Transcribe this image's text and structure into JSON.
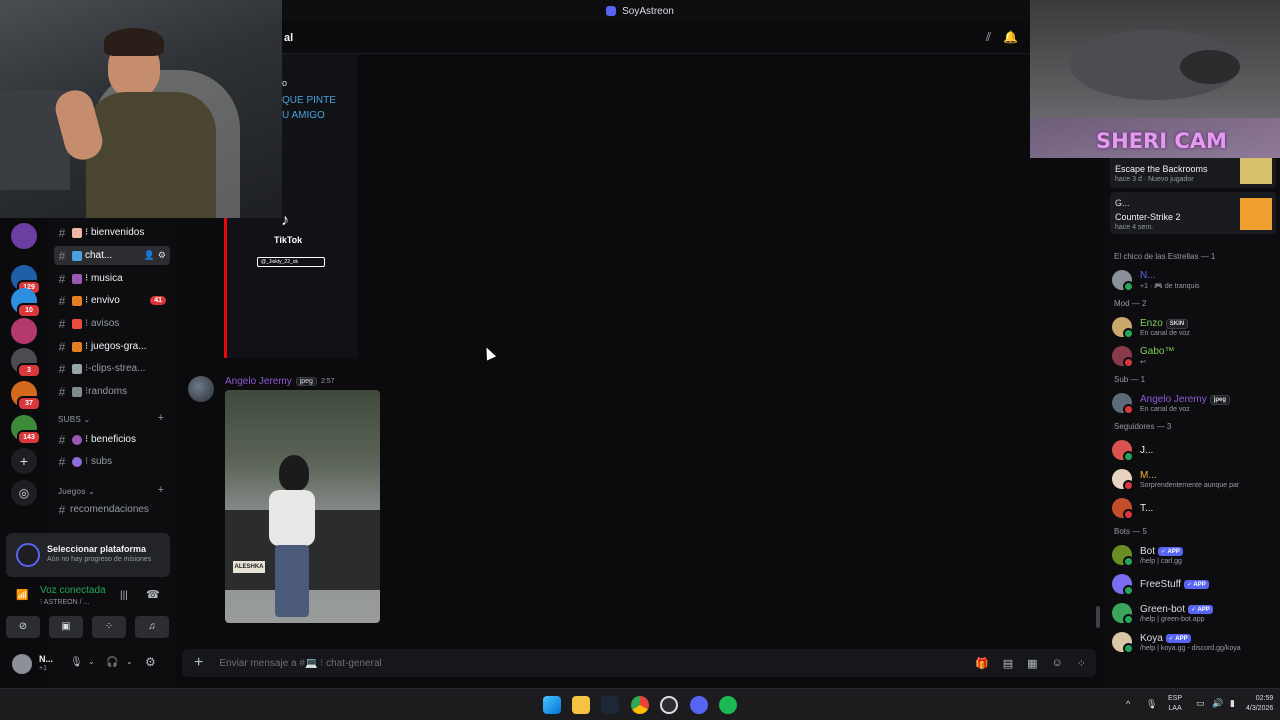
{
  "window": {
    "title": "SoyAstreon"
  },
  "channel_header": {
    "title_fragment": "al"
  },
  "servers": [
    {
      "name": "server-cat-mask",
      "color": "#6b3fa0",
      "badge": ""
    },
    {
      "name": "server-2",
      "color": "#1f5fa8",
      "badge": "129"
    },
    {
      "name": "server-3",
      "color": "#2d8fe0",
      "badge": "10"
    },
    {
      "name": "server-4",
      "color": "#b43a6e",
      "badge": ""
    },
    {
      "name": "server-5",
      "color": "#4a4c52",
      "badge": "3"
    },
    {
      "name": "server-6",
      "color": "#d46a1e",
      "badge": "37"
    },
    {
      "name": "server-7",
      "color": "#3c8a3a",
      "badge": "143"
    }
  ],
  "channels": [
    {
      "label": "⁝ bienvenidos",
      "badge": "",
      "emoji_color": "#f0b7a4"
    },
    {
      "label": "chat...",
      "badge": "",
      "emoji_color": "#4aa3df"
    },
    {
      "label": "⁝ musica",
      "badge": "",
      "emoji_color": "#9b59b6"
    },
    {
      "label": "⁝ envivo",
      "badge": "41",
      "emoji_color": "#e67e22"
    },
    {
      "label": "⁝ avisos",
      "badge": "",
      "emoji_color": "#e74c3c"
    },
    {
      "label": "⁝ juegos-gra...",
      "badge": "",
      "emoji_color": "#e67e22"
    },
    {
      "label": "⁝-clips-strea...",
      "badge": "",
      "emoji_color": "#95a5a6"
    },
    {
      "label": "⁝randoms",
      "badge": "",
      "emoji_color": "#7f8c8d"
    }
  ],
  "categories": {
    "subs": "SUBS",
    "juegos": "Juegos"
  },
  "subs_channels": [
    {
      "label": "⁝ beneficios",
      "emoji_color": "#9b59b6"
    },
    {
      "label": "⁝ subs",
      "emoji_color": "#8e6bd8"
    }
  ],
  "juegos_channels": [
    {
      "label": "recomendaciones"
    }
  ],
  "mission": {
    "title": "Seleccionar plataforma",
    "subtitle": "Aún no hay progreso de misiones"
  },
  "voice": {
    "status": "Voz conectada",
    "channel": "⁝ ASTREON / ..."
  },
  "user": {
    "name": "N...",
    "status": "+1"
  },
  "message": {
    "author": "Angelo Jeremy",
    "badge": "jpeg",
    "time": "2:57",
    "image_caption": "ALESHKA"
  },
  "tiktok_embed": {
    "text_line1": "QUE PINTE",
    "text_line2": "U AMIGO",
    "text_top": "o",
    "brand": "TikTok",
    "handle": "@_Jiekty_22_ok"
  },
  "composer": {
    "placeholder": "Enviar mensaje a #💻 ⁝ chat-general"
  },
  "activity": [
    {
      "name": "",
      "game": "Escape the Backrooms",
      "meta": "hace 3 d",
      "extra": "Nuevo jugador"
    },
    {
      "name": "G...",
      "game": "Counter-Strike 2",
      "meta": "hace 4 sem.",
      "extra": ""
    }
  ],
  "member_sections": [
    {
      "title": "El chico de las Estrellas — 1",
      "members": [
        {
          "name": "N...",
          "sub": "+1 · 🎮 de tranquis",
          "color": "#5865f2",
          "avatar": "#8a8f98",
          "status": "#23a55a",
          "app": false
        }
      ]
    },
    {
      "title": "Mod — 2",
      "members": [
        {
          "name": "Enzo",
          "sub": "En canal de voz",
          "color": "#7ccf57",
          "avatar": "#c9a86a",
          "status": "#23a55a",
          "app": false,
          "tag": "SKIN"
        },
        {
          "name": "Gabo™",
          "sub": "↩",
          "color": "#7ccf57",
          "avatar": "#8a3a4a",
          "status": "#da373c",
          "app": false
        }
      ]
    },
    {
      "title": "Sub — 1",
      "members": [
        {
          "name": "Angelo Jeremy",
          "sub": "En canal de voz",
          "color": "#8e5ad6",
          "avatar": "#5d6a78",
          "status": "#da373c",
          "app": false,
          "tag": "jpeg"
        }
      ]
    },
    {
      "title": "Seguidores — 3",
      "members": [
        {
          "name": "J...",
          "sub": "",
          "color": "#f2f3f5",
          "avatar": "#d9534f",
          "status": "#23a55a",
          "app": false
        },
        {
          "name": "M...",
          "sub": "Sorprendentemente aunque par",
          "color": "#f0b232",
          "avatar": "#e8d4c0",
          "status": "#da373c",
          "app": false
        },
        {
          "name": "T...",
          "sub": "",
          "color": "#f2f3f5",
          "avatar": "#c44e2a",
          "status": "#da373c",
          "app": false
        }
      ]
    },
    {
      "title": "Bots — 5",
      "members": [
        {
          "name": "Bot",
          "sub": "/help | carl.gg",
          "color": "#dbdee1",
          "avatar": "#6b8e23",
          "status": "#23a55a",
          "app": true
        },
        {
          "name": "FreeStuff",
          "sub": "",
          "color": "#dbdee1",
          "avatar": "#7b6cf0",
          "status": "#23a55a",
          "app": true
        },
        {
          "name": "Green-bot",
          "sub": "/help | green-bot.app",
          "color": "#dbdee1",
          "avatar": "#3ba55c",
          "status": "#23a55a",
          "app": true
        },
        {
          "name": "Koya",
          "sub": "/help | koya.gg - discord.gg/koya",
          "color": "#dbdee1",
          "avatar": "#d9c7a8",
          "status": "#23a55a",
          "app": true
        }
      ]
    }
  ],
  "overlay": {
    "cam_label": "SHERI CAM"
  },
  "taskbar": {
    "lang": "ESP",
    "layout": "LAA",
    "time": "02:59",
    "date": "4/3/2026"
  },
  "colors": {
    "accent": "#5865f2",
    "danger": "#da373c",
    "online": "#23a55a"
  }
}
